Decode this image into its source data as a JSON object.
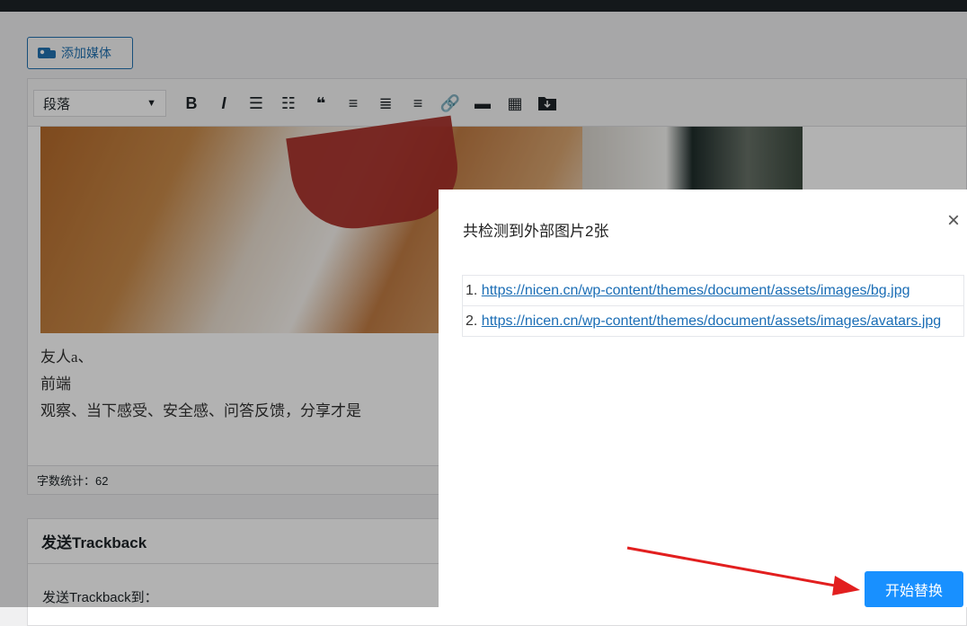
{
  "app": {
    "add_media_label": "添加媒体",
    "format_select": "段落",
    "word_count": "字数统计：62"
  },
  "toolbar_icons": [
    "bold-icon",
    "italic-icon",
    "bullet-list-icon",
    "numbered-list-icon",
    "blockquote-icon",
    "align-left-icon",
    "align-center-icon",
    "align-right-icon",
    "link-icon",
    "read-more-icon",
    "toolbar-toggle-icon",
    "download-icon"
  ],
  "content": {
    "lines": [
      "友人a、",
      "前端",
      "观察、当下感受、安全感、问答反馈，分享才是"
    ]
  },
  "trackback": {
    "title": "发送Trackback",
    "label": "发送Trackback到："
  },
  "dialog": {
    "title": "共检测到外部图片2张",
    "items": [
      {
        "index": "1.",
        "url": "https://nicen.cn/wp-content/themes/document/assets/images/bg.jpg"
      },
      {
        "index": "2.",
        "url": "https://nicen.cn/wp-content/themes/document/assets/images/avatars.jpg"
      }
    ],
    "button": "开始替换"
  },
  "colors": {
    "accent": "#1890ff",
    "link": "#1a6db5",
    "arrow": "#e21f1f"
  }
}
